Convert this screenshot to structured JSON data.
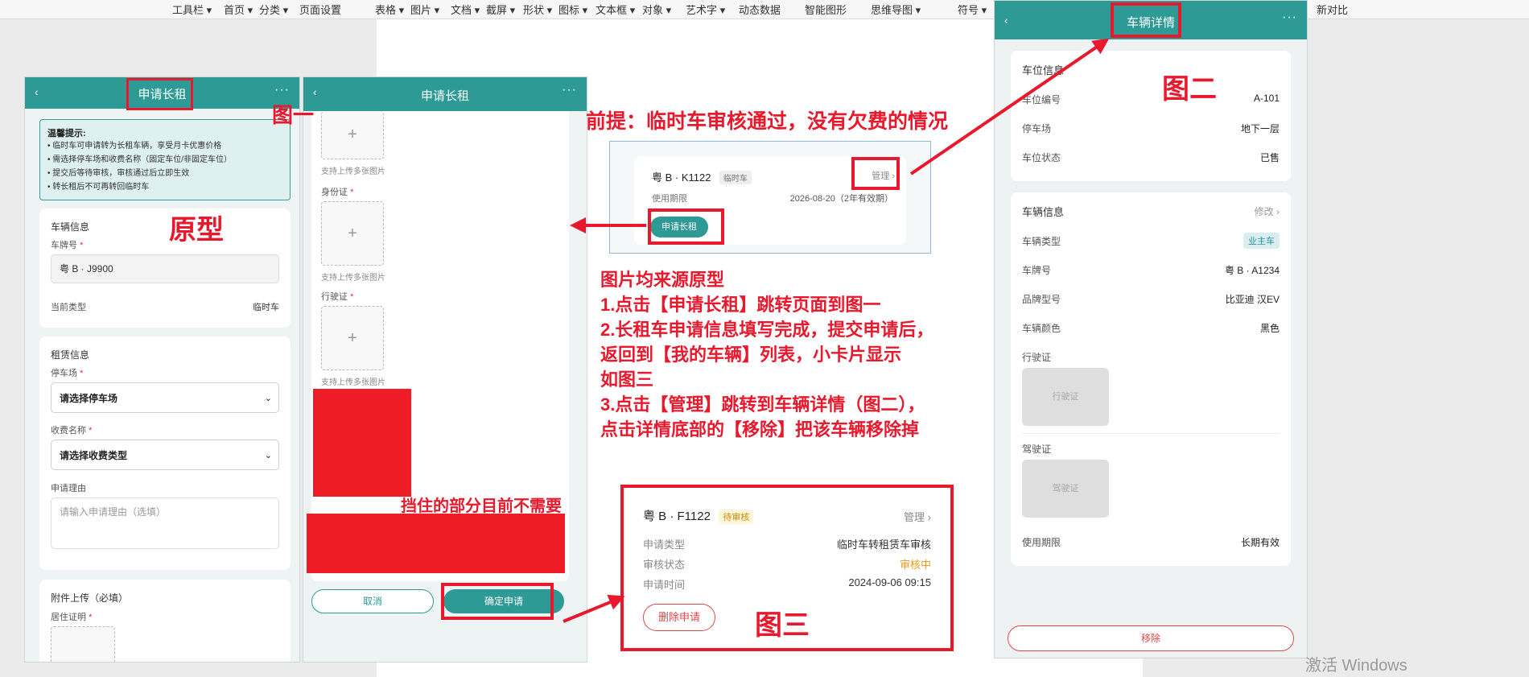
{
  "topbar": {
    "menu": [
      "工具栏 ▾",
      "首页 ▾",
      "分类 ▾",
      "页面设置",
      "表格 ▾",
      "图片 ▾",
      "文档 ▾",
      "截屏 ▾",
      "形状 ▾",
      "图标 ▾",
      "文本框 ▾",
      "对象 ▾",
      "艺术字 ▾",
      "动态数据",
      "智能图形",
      "思维导图 ▾",
      "符号 ▾",
      "新对比"
    ]
  },
  "phone1": {
    "title": "申请长租",
    "back": "‹",
    "more": "···",
    "tips": {
      "title": "温馨提示:",
      "lines": [
        "• 临时车可申请转为长租车辆，享受月卡优惠价格",
        "• 需选择停车场和收费名称（固定车位/非固定车位）",
        "• 提交后等待审核，审核通过后立即生效",
        "• 转长租后不可再转回临时车"
      ]
    },
    "vehicle_section": {
      "title": "车辆信息",
      "plate_label": "车牌号",
      "req": "*",
      "plate_value": "粤 B · J9900",
      "type_label": "当前类型",
      "type_value": "临时车"
    },
    "rent_section": {
      "title": "租赁信息",
      "lot_label": "停车场",
      "lot_placeholder": "请选择停车场",
      "fee_label": "收费名称",
      "fee_placeholder": "请选择收费类型",
      "reason_label": "申请理由",
      "reason_placeholder": "请输入申请理由（选填）"
    },
    "attach_section": {
      "title": "附件上传（必填）",
      "residence_label": "居住证明"
    }
  },
  "phone2": {
    "title": "申请长租",
    "back": "‹",
    "more": "···",
    "upload_hint": "支持上传多张图片",
    "id_label": "身份证",
    "license_label": "行驶证",
    "plus": "+",
    "cancel": "取消",
    "confirm": "确定申请"
  },
  "annotations": {
    "fig1": "图一",
    "prototype": "原型",
    "premise": "前提：临时车审核通过，没有欠费的情况",
    "notes": [
      "图片均来源原型",
      "1.点击【申请长租】跳转页面到图一",
      "2.长租车申请信息填写完成，提交申请后，",
      "返回到【我的车辆】列表，小卡片显示",
      "如图三",
      "3.点击【管理】跳转到车辆详情（图二），",
      "点击详情底部的【移除】把该车辆移除掉"
    ],
    "masked": "挡住的部分目前不需要",
    "fig2": "图二",
    "fig3": "图三"
  },
  "snippet_top": {
    "plate": "粤 B · K1122",
    "tag": "临时车",
    "manage": "管理 ›",
    "period_label": "使用期限",
    "period_value": "2026-08-20（2年有效期）",
    "apply_button": "申请长租"
  },
  "snippet_bottom": {
    "plate": "粤 B · F1122",
    "tag": "待审核",
    "manage": "管理 ›",
    "rows": [
      {
        "label": "申请类型",
        "value": "临时车转租赁车审核"
      },
      {
        "label": "审核状态",
        "value": "审核中"
      },
      {
        "label": "申请时间",
        "value": "2024-09-06 09:15"
      }
    ],
    "delete_button": "删除申请"
  },
  "phone3": {
    "title": "车辆详情",
    "back": "‹",
    "more": "···",
    "space_section": {
      "title": "车位信息",
      "rows": [
        {
          "label": "车位编号",
          "value": "A-101"
        },
        {
          "label": "停车场",
          "value": "地下一层"
        },
        {
          "label": "车位状态",
          "value": "已售"
        }
      ]
    },
    "vehicle_section": {
      "title": "车辆信息",
      "edit": "修改 ›",
      "type_label": "车辆类型",
      "type_value": "业主车",
      "plate_label": "车牌号",
      "plate_value": "粤 B · A1234",
      "brand_label": "品牌型号",
      "brand_value": "比亚迪 汉EV",
      "color_label": "车辆颜色",
      "color_value": "黑色",
      "license_label": "行驶证",
      "license_thumb": "行驶证",
      "driver_label": "驾驶证",
      "driver_thumb": "驾驶证",
      "period_label": "使用期限",
      "period_value": "长期有效"
    },
    "remove": "移除"
  },
  "watermark": "激活 Windows",
  "colors": {
    "teal": "#2d9a96",
    "annotation_red": "#e8192c",
    "pending_orange": "#f39a1e"
  }
}
